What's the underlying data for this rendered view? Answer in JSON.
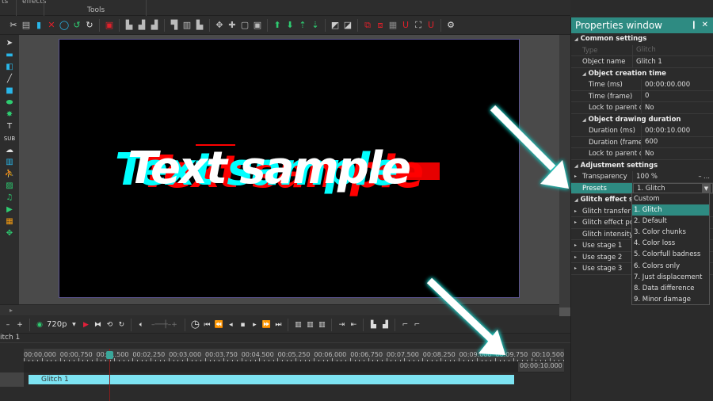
{
  "top_tabs": [
    "ts",
    "effects"
  ],
  "toolbar": {
    "group_label": "Tools",
    "icons": [
      "cut-icon",
      "copy-icon",
      "paste-icon",
      "delete-icon",
      "circle-icon",
      "undo-icon",
      "redo-icon",
      "select-all-icon",
      "align-left-icon",
      "align-center-icon",
      "align-right-icon",
      "align-top-icon",
      "align-middle-icon",
      "align-bottom-icon",
      "distribute-horizontal-icon",
      "distribute-vertical-icon",
      "stretch-icon",
      "fit-icon",
      "bring-to-front-icon",
      "send-to-back-icon",
      "bring-forward-icon",
      "send-backward-icon",
      "group-icon",
      "ungroup-icon",
      "snap-icon",
      "snap-grid-icon",
      "grid-icon",
      "magnet-icon",
      "bounds-icon",
      "magnet2-icon",
      "settings-icon"
    ]
  },
  "left_tools": [
    "pointer-tool",
    "layers-tool",
    "layers2-tool",
    "line-tool",
    "rectangle-tool",
    "ellipse-tool",
    "shape-tool",
    "text-tool",
    "subtitle-tool",
    "callout-tool",
    "chart-tool",
    "animation-tool",
    "image-tool",
    "audio-tool",
    "video-tool",
    "equalizer-tool",
    "move-tool"
  ],
  "preview": {
    "text": "Text sample",
    "colors": {
      "red": "#ff0000",
      "cyan": "#00ffff",
      "white": "#ffffff"
    }
  },
  "playback": {
    "resolution": "720p"
  },
  "timeline": {
    "header_label": "itch 1",
    "ruler_labels": [
      "00:00.000",
      "00:00.750",
      "00:01.500",
      "00:02.250",
      "00:03.000",
      "00:03.750",
      "00:04.500",
      "00:05.250",
      "00:06.000",
      "00:06.750",
      "00:07.500",
      "00:08.250",
      "00:09.000",
      "00:09.750",
      "00:10.500"
    ],
    "end_time": "00:00:10.000",
    "clip_label": "Glitch 1"
  },
  "properties": {
    "title": "Properties window",
    "pin_label": "❙",
    "close_label": "✕",
    "common_settings": "Common settings",
    "type_key": "Type",
    "type_val": "Glitch",
    "name_key": "Object name",
    "name_val": "Glitch 1",
    "creation_time": "Object creation time",
    "time_ms_key": "Time (ms)",
    "time_ms_val": "00:00:00.000",
    "time_frame_key": "Time (frame)",
    "time_frame_val": "0",
    "lock1_key": "Lock to parent du",
    "lock1_val": "No",
    "drawing_duration": "Object drawing duration",
    "dur_ms_key": "Duration (ms)",
    "dur_ms_val": "00:00:10.000",
    "dur_frames_key": "Duration (frames)",
    "dur_frames_val": "600",
    "lock2_key": "Lock to parent du",
    "lock2_val": "No",
    "adjustment": "Adjustment settings",
    "transparency_key": "Transparency",
    "transparency_val": "100 %",
    "presets_key": "Presets",
    "presets_val": "1. Glitch",
    "glitch_settings": "Glitch effect set",
    "glitch_rows": [
      "Glitch transfer po",
      "Glitch effect powe",
      "Glitch intensity",
      "Use stage 1",
      "Use stage 2",
      "Use stage 3"
    ]
  },
  "presets_dropdown": {
    "options": [
      "Custom",
      "1. Glitch",
      "2. Default",
      "3. Color chunks",
      "4. Color loss",
      "5. Colorfull badness",
      "6. Colors only",
      "7. Just displacement",
      "8. Data difference",
      "9. Minor damage"
    ],
    "selected": "1. Glitch"
  },
  "accent_color": "#2e8b82",
  "clip_color": "#7de3f2"
}
